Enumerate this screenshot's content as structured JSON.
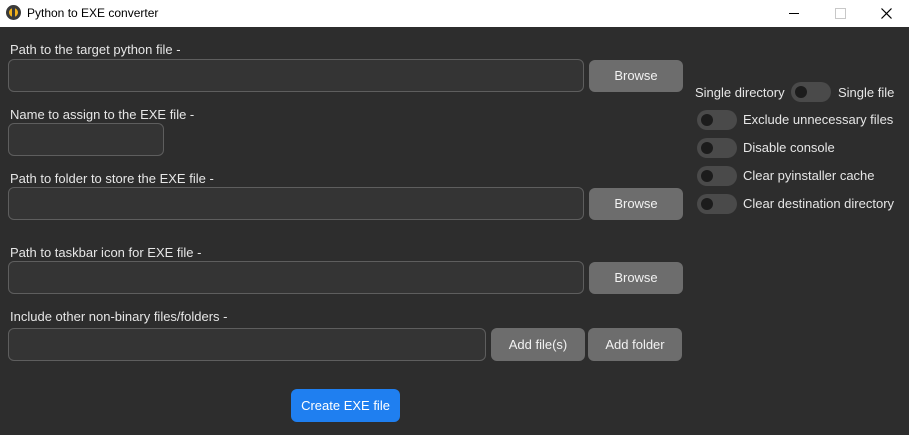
{
  "window": {
    "title": "Python to EXE converter",
    "icon": "python-icon"
  },
  "form": {
    "target_file": {
      "label": "Path to the target python file -",
      "value": "",
      "button": "Browse"
    },
    "exe_name": {
      "label": "Name to assign to the EXE file -",
      "value": ""
    },
    "output_folder": {
      "label": "Path to folder to store the EXE file -",
      "value": "",
      "button": "Browse"
    },
    "icon_path": {
      "label": "Path to taskbar icon for EXE file -",
      "value": "",
      "button": "Browse"
    },
    "extra_files": {
      "label": "Include other non-binary files/folders -",
      "value": "",
      "add_files_button": "Add file(s)",
      "add_folder_button": "Add folder"
    },
    "create_button": "Create EXE file"
  },
  "options": {
    "mode_left_label": "Single directory",
    "mode_right_label": "Single file",
    "switches": [
      {
        "label": "Exclude unnecessary files",
        "on": false
      },
      {
        "label": "Disable console",
        "on": false
      },
      {
        "label": "Clear pyinstaller cache",
        "on": false
      },
      {
        "label": "Clear destination directory",
        "on": false
      }
    ],
    "mode_single_file": false
  },
  "colors": {
    "background": "#2d2d2d",
    "button": "#6d6d6d",
    "accent": "#1f7ff0"
  }
}
